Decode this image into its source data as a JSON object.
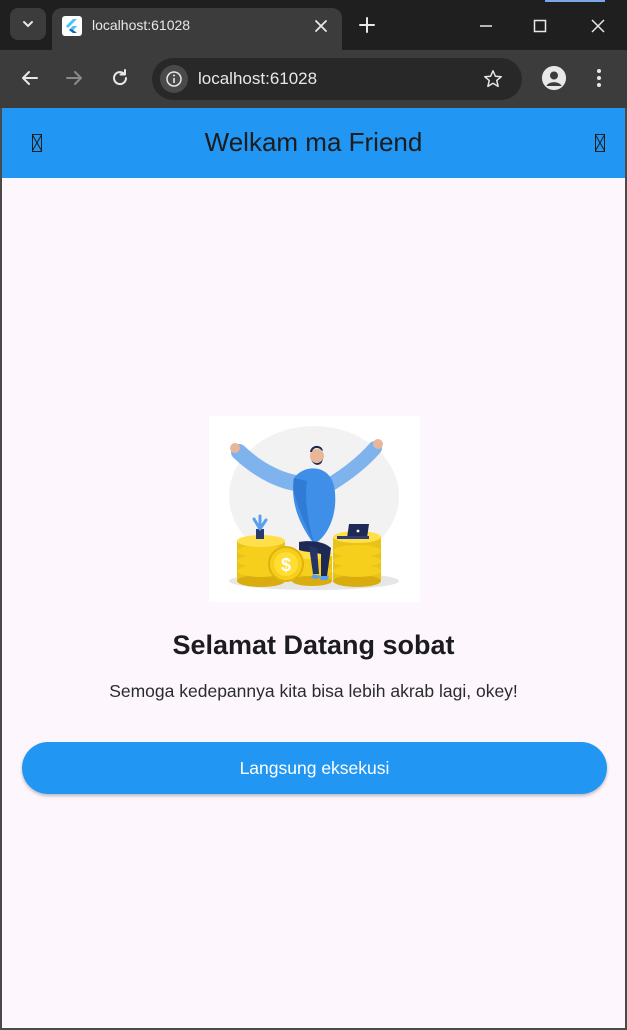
{
  "browser": {
    "tab": {
      "title": "localhost:61028",
      "favicon_icon": "flutter-logo-icon",
      "close_icon": "close-icon"
    },
    "new_tab_icon": "plus-icon",
    "tab_search_icon": "chevron-down-icon",
    "window_controls": [
      "minimize-icon",
      "maximize-icon",
      "close-icon"
    ],
    "address_bar": {
      "url": "localhost:61028",
      "site_info_icon": "info-icon",
      "bookmark_icon": "star-icon"
    },
    "nav_icons": [
      "back-arrow-icon",
      "forward-arrow-icon",
      "reload-icon"
    ],
    "profile_icon": "profile-icon",
    "menu_icon": "kebab-menu-icon"
  },
  "app": {
    "appbar": {
      "title": "Welkam ma Friend",
      "left_icon": "missing-glyph-icon",
      "right_icon": "missing-glyph-icon",
      "background": "#2196f3"
    },
    "hero_image": "money-celebration-illustration",
    "heading": "Selamat Datang sobat",
    "subtitle": "Semoga kedepannya kita bisa lebih akrab lagi, okey!",
    "cta_label": "Langsung eksekusi",
    "accent_color": "#2196f3",
    "background": "#fdf7fd"
  }
}
